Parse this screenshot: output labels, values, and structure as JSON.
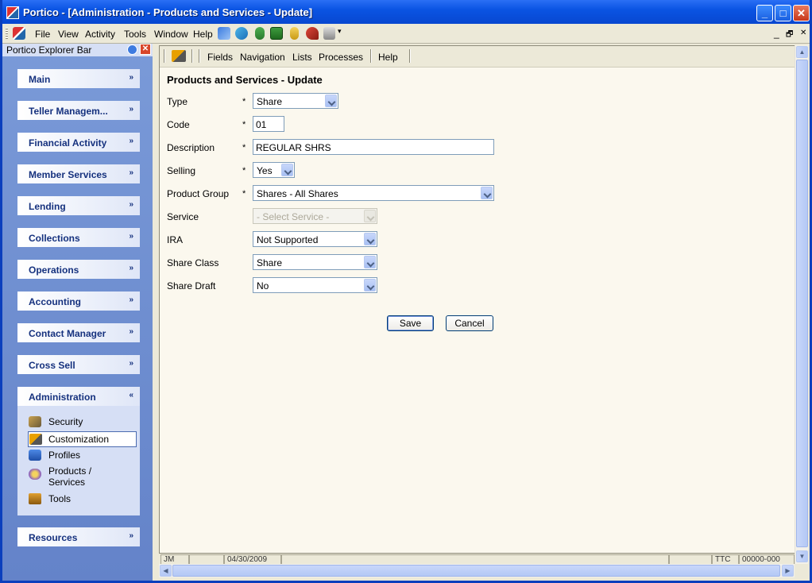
{
  "window": {
    "title": "Portico - [Administration - Products and Services - Update]",
    "minimize": "_",
    "maximize": "□",
    "close": "✕"
  },
  "menu": {
    "file": "File",
    "view": "View",
    "activity": "Activity",
    "tools": "Tools",
    "window": "Window",
    "help": "Help",
    "mdi_min": "_",
    "mdi_restore": "🗗",
    "mdi_close": "✕"
  },
  "explorer": {
    "title": "Portico Explorer Bar",
    "close": "✕",
    "sections": [
      {
        "label": "Main",
        "chevron": "»"
      },
      {
        "label": "Teller Managem...",
        "chevron": "»"
      },
      {
        "label": "Financial Activity",
        "chevron": "»"
      },
      {
        "label": "Member Services",
        "chevron": "»"
      },
      {
        "label": "Lending",
        "chevron": "»"
      },
      {
        "label": "Collections",
        "chevron": "»"
      },
      {
        "label": "Operations",
        "chevron": "»"
      },
      {
        "label": "Accounting",
        "chevron": "»"
      },
      {
        "label": "Contact Manager",
        "chevron": "»"
      },
      {
        "label": "Cross Sell",
        "chevron": "»"
      },
      {
        "label": "Administration",
        "chevron": "«"
      },
      {
        "label": "Resources",
        "chevron": "»"
      }
    ],
    "admin_items": [
      {
        "label": "Security",
        "icon": "security-icon"
      },
      {
        "label": "Customization",
        "icon": "customization-icon"
      },
      {
        "label": "Profiles",
        "icon": "profiles-icon"
      },
      {
        "label": "Products /\nServices",
        "icon": "products-services-icon"
      },
      {
        "label": "Tools",
        "icon": "tools-icon"
      }
    ]
  },
  "toolbar": {
    "fields": "Fields",
    "navigation": "Navigation",
    "lists": "Lists",
    "processes": "Processes",
    "help": "Help"
  },
  "form": {
    "title": "Products and Services - Update",
    "required_marker": "*",
    "type": {
      "label": "Type",
      "value": "Share"
    },
    "code": {
      "label": "Code",
      "value": "01"
    },
    "description": {
      "label": "Description",
      "value": "REGULAR SHRS"
    },
    "selling": {
      "label": "Selling",
      "value": "Yes"
    },
    "product_group": {
      "label": "Product Group",
      "value": "Shares - All Shares"
    },
    "service": {
      "label": "Service",
      "value": "- Select Service -"
    },
    "ira": {
      "label": "IRA",
      "value": "Not Supported"
    },
    "share_class": {
      "label": "Share Class",
      "value": "Share"
    },
    "share_draft": {
      "label": "Share Draft",
      "value": "No"
    },
    "save": "Save",
    "cancel": "Cancel"
  },
  "status": {
    "cell1": "JM",
    "cell3": "04/30/2009",
    "cell6": "TTC",
    "cell7": "00000-000"
  }
}
